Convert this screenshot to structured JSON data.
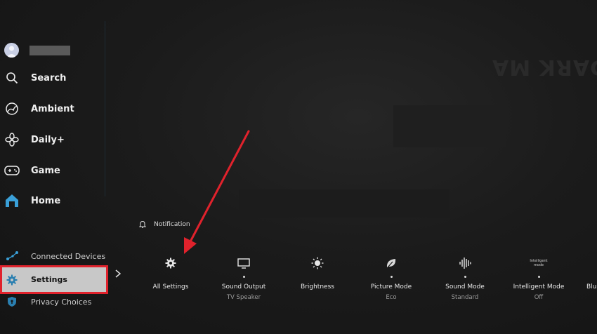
{
  "colors": {
    "background": "#171717",
    "highlight_border": "#e0222c",
    "selected_bg": "#c8c8c8",
    "home_accent": "#3aa0d8",
    "settings_accent": "#2a7fb0"
  },
  "background": {
    "ghost_title": "DARK MA"
  },
  "sidebar": {
    "profile": {
      "icon": "avatar-icon"
    },
    "items": [
      {
        "label": "Search",
        "icon": "search-icon"
      },
      {
        "label": "Ambient",
        "icon": "ambient-icon"
      },
      {
        "label": "Daily+",
        "icon": "daily-plus-icon"
      },
      {
        "label": "Game",
        "icon": "gamepad-icon"
      },
      {
        "label": "Home",
        "icon": "home-icon"
      }
    ],
    "connected_devices": {
      "label": "Connected Devices",
      "icon": "connected-devices-icon"
    },
    "settings": {
      "label": "Settings",
      "icon": "gear-icon"
    },
    "privacy": {
      "label": "Privacy Choices",
      "icon": "shield-icon"
    }
  },
  "quick_panel": {
    "notification": {
      "label": "Notification",
      "icon": "bell-icon"
    },
    "items": [
      {
        "label": "All Settings",
        "sub": "",
        "icon": "gear-icon"
      },
      {
        "label": "Sound Output",
        "sub": "TV Speaker",
        "icon": "monitor-icon"
      },
      {
        "label": "Brightness",
        "sub": "",
        "icon": "sun-icon"
      },
      {
        "label": "Picture Mode",
        "sub": "Eco",
        "icon": "leaf-icon"
      },
      {
        "label": "Sound Mode",
        "sub": "Standard",
        "icon": "soundwave-icon"
      },
      {
        "label": "Intelligent Mode",
        "sub": "Off",
        "icon": "intelligent-mode-icon",
        "icon_text": "Intelligent mode"
      },
      {
        "label": "Blu",
        "sub": "",
        "icon": ""
      }
    ]
  }
}
